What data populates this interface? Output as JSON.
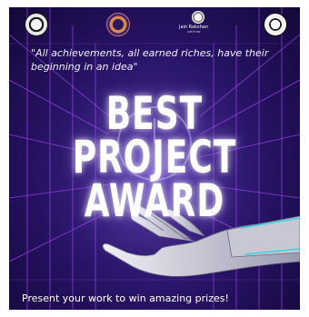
{
  "poster": {
    "quote": "\"All achievements, all earned riches, have their beginning in an idea\"",
    "title_line1": "BEST",
    "title_line2": "PROJECT",
    "title_line3": "AWARD",
    "footer": "Present your work to win amazing prizes!",
    "logo3_text": "Jain Rakshan",
    "logo3_subtext": "ऊर्जा के साथ"
  },
  "colors": {
    "background_dark": "#140838",
    "background_mid": "#4a2a9a",
    "grid_line": "#b04cff",
    "text": "#ffffff",
    "hand": "#dcdce6"
  }
}
